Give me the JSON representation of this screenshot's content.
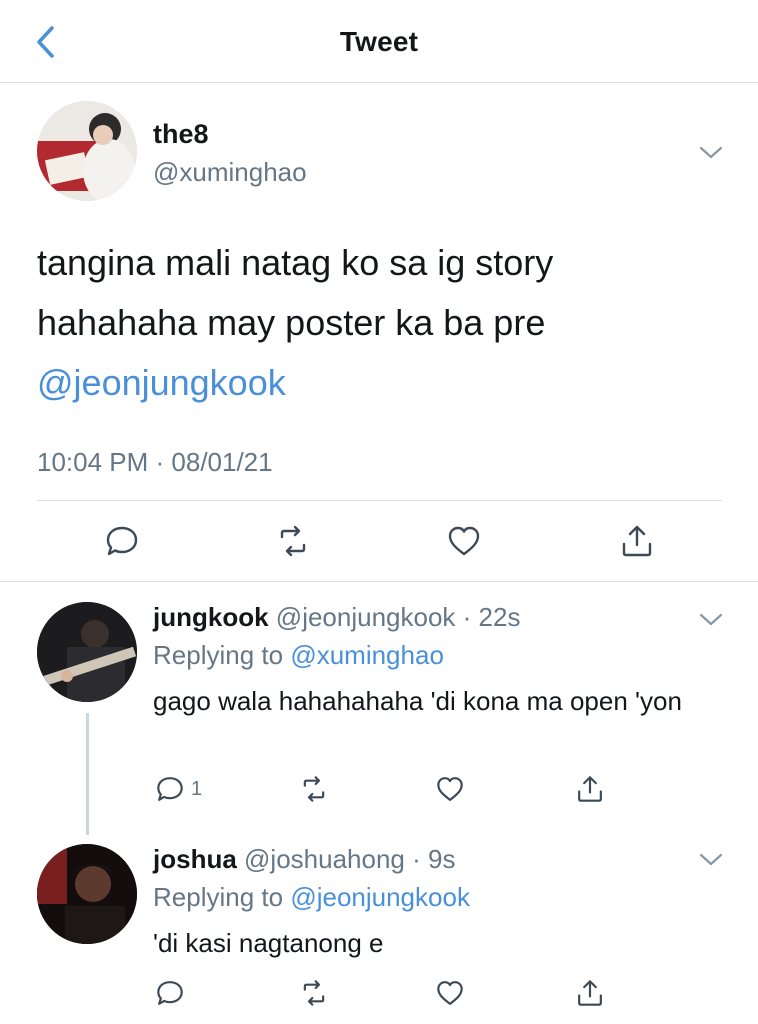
{
  "header": {
    "title": "Tweet",
    "back_icon": "chevron-left-icon"
  },
  "main_tweet": {
    "author_name": "the8",
    "author_handle": "@xuminghao",
    "text_line1": "tangina mali natag ko sa ig story",
    "text_line2": "hahahaha may poster ka ba pre",
    "mention": "@jeonjungkook",
    "timestamp": "10:04 PM · 08/01/21",
    "actions": [
      "comment-icon",
      "retweet-icon",
      "heart-icon",
      "share-icon"
    ]
  },
  "replies": [
    {
      "name": "jungkook",
      "meta": "@jeonjungkook · 22s",
      "replying_prefix": "Replying to",
      "replying_to": "@xuminghao",
      "text": "gago wala hahahahaha 'di kona ma open 'yon",
      "reply_count": "1"
    },
    {
      "name": "joshua",
      "meta": "@joshuahong · 9s",
      "replying_prefix": "Replying to",
      "replying_to": "@jeonjungkook",
      "text": "'di kasi nagtanong e",
      "reply_count": ""
    }
  ],
  "colors": {
    "accent": "#4a90d9",
    "muted": "#657786",
    "text": "#14171a",
    "divider": "#dcdfe2"
  }
}
